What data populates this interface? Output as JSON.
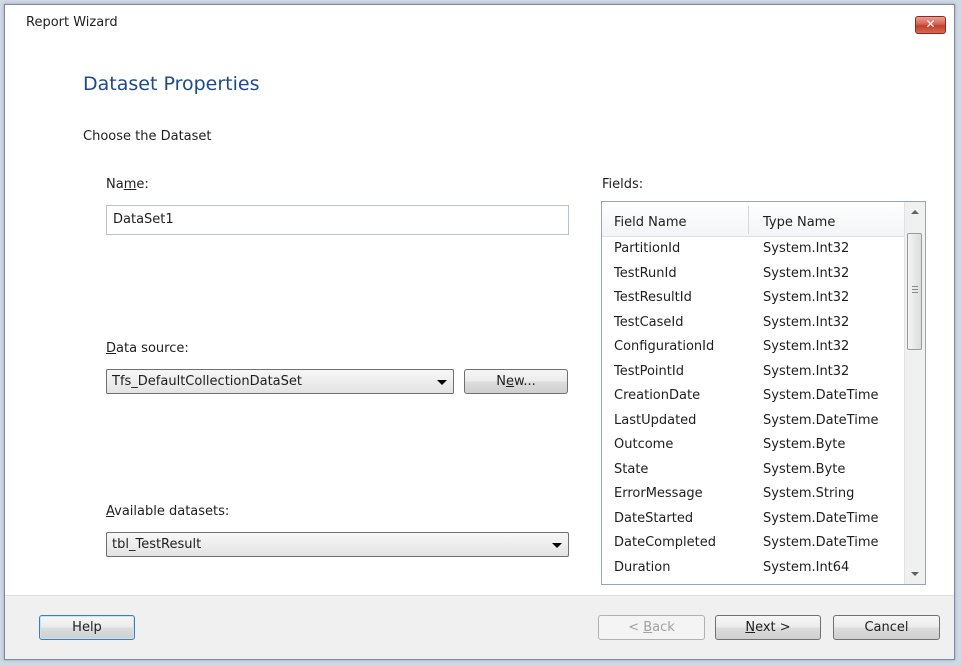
{
  "window": {
    "title": "Report Wizard",
    "close_glyph": "✕"
  },
  "page": {
    "title": "Dataset Properties",
    "subtitle": "Choose the Dataset"
  },
  "name_field": {
    "label_pre": "Na",
    "label_key": "m",
    "label_post": "e:",
    "value": "DataSet1"
  },
  "data_source": {
    "label_key": "D",
    "label_post": "ata source:",
    "selected": "Tfs_DefaultCollectionDataSet",
    "new_pre": "N",
    "new_key": "e",
    "new_post": "w..."
  },
  "available": {
    "label_key": "A",
    "label_post": "vailable datasets:",
    "selected": "tbl_TestResult"
  },
  "fields": {
    "label": "Fields:",
    "columns": [
      "Field Name",
      "Type Name"
    ],
    "rows": [
      [
        "PartitionId",
        "System.Int32"
      ],
      [
        "TestRunId",
        "System.Int32"
      ],
      [
        "TestResultId",
        "System.Int32"
      ],
      [
        "TestCaseId",
        "System.Int32"
      ],
      [
        "ConfigurationId",
        "System.Int32"
      ],
      [
        "TestPointId",
        "System.Int32"
      ],
      [
        "CreationDate",
        "System.DateTime"
      ],
      [
        "LastUpdated",
        "System.DateTime"
      ],
      [
        "Outcome",
        "System.Byte"
      ],
      [
        "State",
        "System.Byte"
      ],
      [
        "ErrorMessage",
        "System.String"
      ],
      [
        "DateStarted",
        "System.DateTime"
      ],
      [
        "DateCompleted",
        "System.DateTime"
      ],
      [
        "Duration",
        "System.Int64"
      ]
    ]
  },
  "buttons": {
    "help": "Help",
    "back_pre": "< ",
    "back_key": "B",
    "back_post": "ack",
    "next_key": "N",
    "next_post": "ext >",
    "cancel": "Cancel"
  },
  "colors": {
    "title_blue": "#1e4a8a",
    "close_red": "#c2402c",
    "footer_bg": "#f0f0f0"
  }
}
